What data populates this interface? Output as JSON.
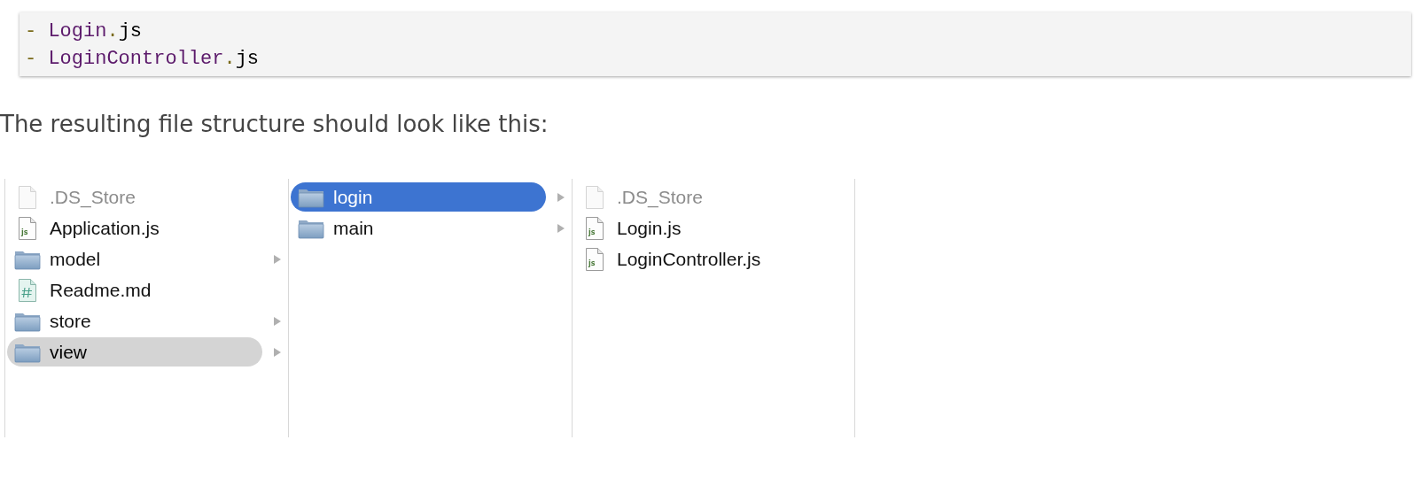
{
  "code_block": {
    "lines": [
      {
        "tokens": [
          {
            "kind": "punct",
            "text": "- "
          },
          {
            "kind": "name",
            "text": "Login"
          },
          {
            "kind": "punct",
            "text": "."
          },
          {
            "kind": "plain",
            "text": "js"
          }
        ]
      },
      {
        "tokens": [
          {
            "kind": "punct",
            "text": "- "
          },
          {
            "kind": "name",
            "text": "LoginController"
          },
          {
            "kind": "punct",
            "text": "."
          },
          {
            "kind": "plain",
            "text": "js"
          }
        ]
      }
    ]
  },
  "paragraph": "The resulting file structure should look like this:",
  "finder": {
    "columns": [
      {
        "items": [
          {
            "kind": "file",
            "name": ".DS_Store",
            "dimmed": true,
            "selected": false
          },
          {
            "kind": "js",
            "name": "Application.js",
            "dimmed": false,
            "selected": false
          },
          {
            "kind": "folder",
            "name": "model",
            "dimmed": false,
            "selected": false
          },
          {
            "kind": "md",
            "name": "Readme.md",
            "dimmed": false,
            "selected": false
          },
          {
            "kind": "folder",
            "name": "store",
            "dimmed": false,
            "selected": false
          },
          {
            "kind": "folder",
            "name": "view",
            "dimmed": false,
            "selected": true
          }
        ]
      },
      {
        "items": [
          {
            "kind": "folder",
            "name": "login",
            "dimmed": false,
            "selected": true
          },
          {
            "kind": "folder",
            "name": "main",
            "dimmed": false,
            "selected": false
          }
        ]
      },
      {
        "items": [
          {
            "kind": "file",
            "name": ".DS_Store",
            "dimmed": true,
            "selected": false
          },
          {
            "kind": "js",
            "name": "Login.js",
            "dimmed": false,
            "selected": false
          },
          {
            "kind": "js",
            "name": "LoginController.js",
            "dimmed": false,
            "selected": false
          }
        ]
      }
    ]
  }
}
